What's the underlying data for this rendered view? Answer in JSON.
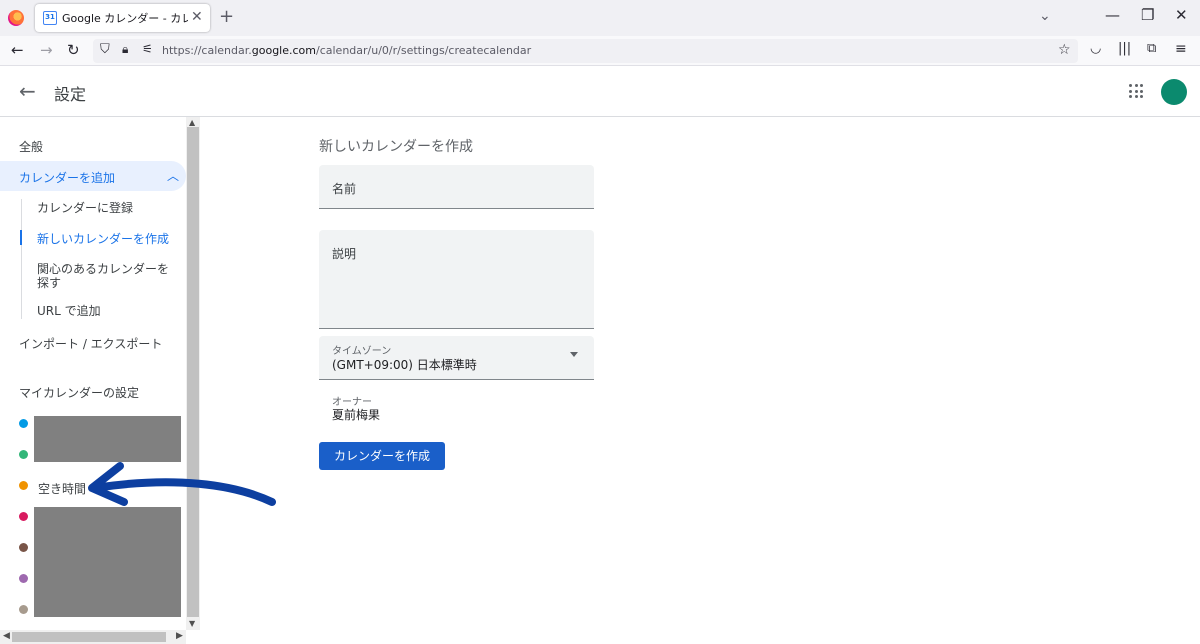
{
  "browser": {
    "tab_title": "Google カレンダー - カレンダーを作成",
    "tab_favicon_text": "31",
    "url_prefix": "https://calendar.",
    "url_domain": "google.com",
    "url_path": "/calendar/u/0/r/settings/createcalendar"
  },
  "header": {
    "title": "設定"
  },
  "sidebar": {
    "general": "全般",
    "add_calendar": "カレンダーを追加",
    "sub_items": [
      "カレンダーに登録",
      "新しいカレンダーを作成",
      "関心のあるカレンダーを探す",
      "URL で追加"
    ],
    "import_export": "インポート / エクスポート",
    "my_calendars_title": "マイカレンダーの設定",
    "calendars": [
      {
        "color": "#039be5"
      },
      {
        "color": "#33b679"
      },
      {
        "color": "#f09300",
        "label": "空き時間"
      },
      {
        "color": "#d81b60"
      },
      {
        "color": "#795548"
      },
      {
        "color": "#9e69af"
      },
      {
        "color": "#a79b8e"
      }
    ]
  },
  "form": {
    "title": "新しいカレンダーを作成",
    "name_label": "名前",
    "description_label": "説明",
    "timezone_label": "タイムゾーン",
    "timezone_value": "(GMT+09:00) 日本標準時",
    "owner_label": "オーナー",
    "owner_value": "夏前梅果",
    "create_button": "カレンダーを作成"
  },
  "colors": {
    "accent": "#1a73e8",
    "button": "#1a5fc9",
    "annotation_arrow": "#0d3fa0",
    "avatar": "#0b8a6e"
  }
}
